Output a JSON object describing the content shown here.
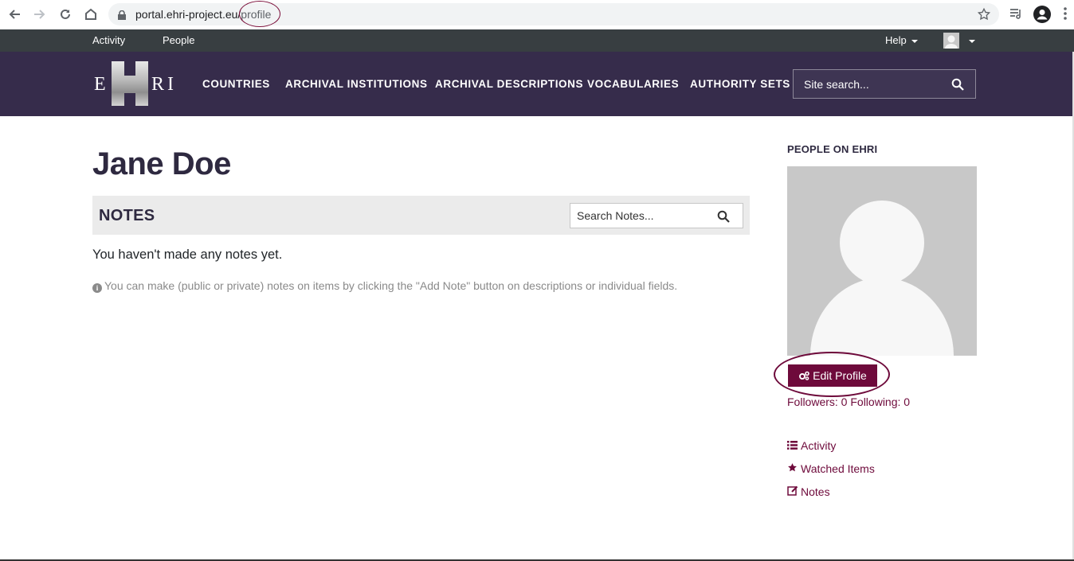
{
  "browser": {
    "url_host": "portal.ehri-project.eu/",
    "url_path": "profile"
  },
  "topbar": {
    "activity": "Activity",
    "people": "People",
    "help": "Help"
  },
  "nav": {
    "logo_letters": [
      "E",
      "R",
      "I"
    ],
    "links": [
      "COUNTRIES",
      "ARCHIVAL INSTITUTIONS",
      "ARCHIVAL DESCRIPTIONS",
      "VOCABULARIES",
      "AUTHORITY SETS"
    ],
    "search_placeholder": "Site search..."
  },
  "main": {
    "title": "Jane Doe",
    "notes_heading": "NOTES",
    "notes_search_placeholder": "Search Notes...",
    "empty_message": "You haven't made any notes yet.",
    "hint": "You can make (public or private) notes on items by clicking the \"Add Note\" button on descriptions or individual fields."
  },
  "sidebar": {
    "title": "PEOPLE ON EHRI",
    "edit_button": "Edit Profile",
    "followers": "Followers: 0 Following: 0",
    "links": [
      "Activity",
      "Watched Items",
      "Notes"
    ]
  },
  "colors": {
    "nav_bg": "#362c4b",
    "topbar_bg": "#383e41",
    "accent": "#6e0a3b"
  }
}
